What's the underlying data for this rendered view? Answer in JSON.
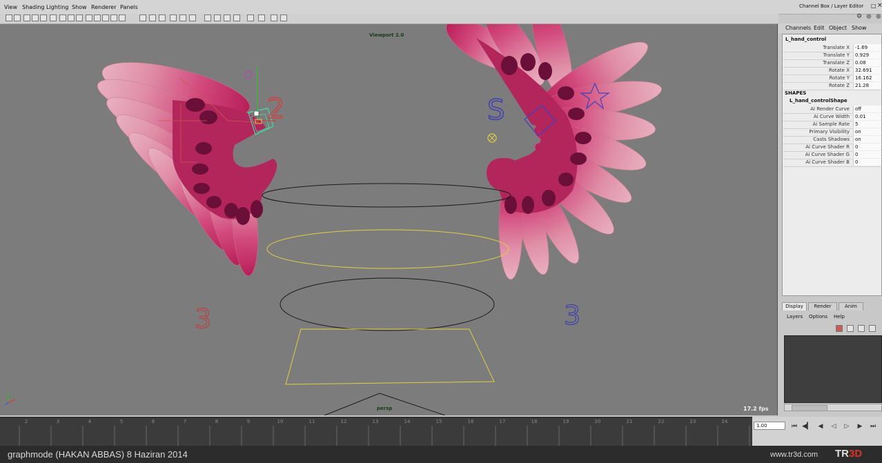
{
  "menu": [
    "View",
    "Shading",
    "Lighting",
    "Show",
    "Renderer",
    "Panels"
  ],
  "viewport": {
    "label": "Viewport 2.0",
    "camera": "persp",
    "fps": "17.2 fps",
    "letters": {
      "left_top": "2",
      "right_top": "S",
      "left_bottom": "3",
      "right_bottom": "3"
    }
  },
  "panel": {
    "title": "Channel Box / Layer Editor"
  },
  "channel_box": {
    "menu": [
      "Channels",
      "Edit",
      "Object",
      "Show"
    ],
    "object_name": "L_hand_control",
    "channels": [
      {
        "label": "Translate X",
        "value": "-1.69"
      },
      {
        "label": "Translate Y",
        "value": "0.929"
      },
      {
        "label": "Translate Z",
        "value": "0.08"
      },
      {
        "label": "Rotate X",
        "value": "32.691"
      },
      {
        "label": "Rotate Y",
        "value": "16.162"
      },
      {
        "label": "Rotate Z",
        "value": "21.28"
      }
    ],
    "shapes_header": "SHAPES",
    "shape_name": "L_hand_controlShape",
    "shape_attrs": [
      {
        "label": "Ai Render Curve",
        "value": "off"
      },
      {
        "label": "Ai Curve Width",
        "value": "0.01"
      },
      {
        "label": "Ai Sample Rate",
        "value": "5"
      },
      {
        "label": "Primary Visibility",
        "value": "on"
      },
      {
        "label": "Casts Shadows",
        "value": "on"
      },
      {
        "label": "Ai Curve Shader R",
        "value": "0"
      },
      {
        "label": "Ai Curve Shader G",
        "value": "0"
      },
      {
        "label": "Ai Curve Shader B",
        "value": "0"
      }
    ]
  },
  "layer_editor": {
    "tabs": [
      "Display",
      "Render",
      "Anim"
    ],
    "menu": [
      "Layers",
      "Options",
      "Help"
    ]
  },
  "timeline": {
    "ticks": [
      "2",
      "3",
      "4",
      "5",
      "6",
      "7",
      "8",
      "9",
      "10",
      "11",
      "12",
      "13",
      "14",
      "15",
      "16",
      "17",
      "18",
      "19",
      "20",
      "21",
      "22",
      "23",
      "24"
    ],
    "current_frame": "1.00"
  },
  "footer": {
    "caption": "graphmode (HAKAN ABBAS)  8 Haziran 2014",
    "url": "www.tr3d.com",
    "logo_a": "TR",
    "logo_b": "3D"
  },
  "colors": {
    "viewport_bg": "#7c7c7c",
    "feather_pink": "#d88aa0",
    "feather_magenta": "#cc2d6a",
    "feather_dark": "#6a0f38",
    "curve_yellow": "#e0d040",
    "curve_black": "#1a1a1a"
  }
}
